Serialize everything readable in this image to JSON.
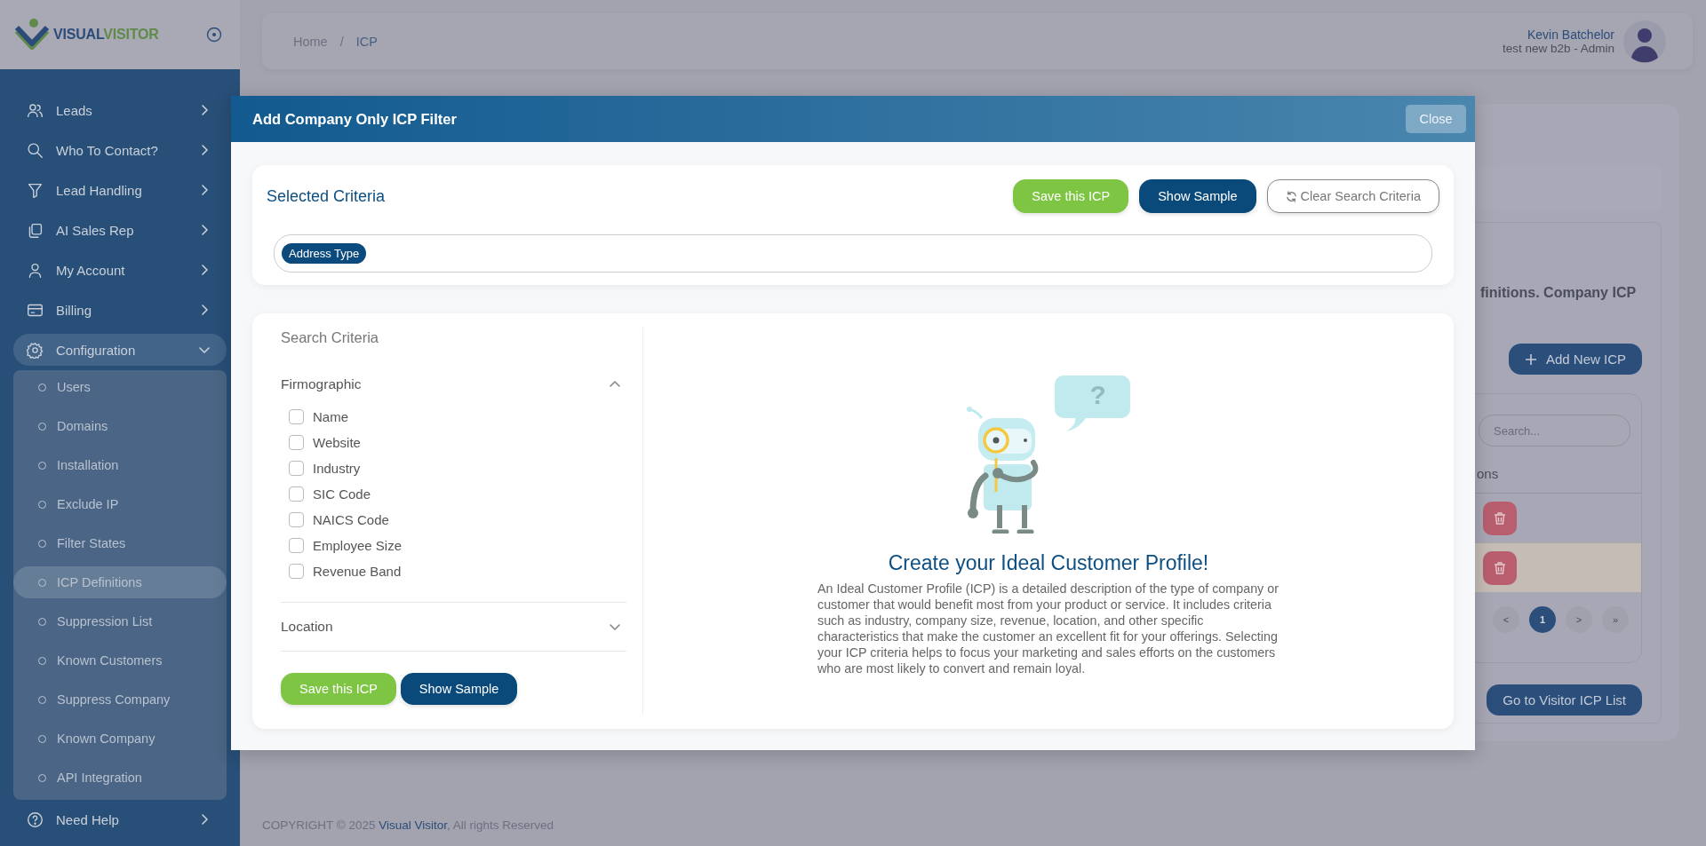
{
  "sidebar": {
    "logo": {
      "part_1": "VISUAL",
      "part_2": "VISITOR"
    },
    "items": [
      {
        "label": "Leads",
        "expanded": false,
        "selected": false
      },
      {
        "label": "Who To Contact?",
        "expanded": false,
        "selected": false
      },
      {
        "label": "Lead Handling",
        "expanded": false,
        "selected": false
      },
      {
        "label": "AI Sales Rep",
        "expanded": false,
        "selected": false
      },
      {
        "label": "My Account",
        "expanded": false,
        "selected": false
      },
      {
        "label": "Billing",
        "expanded": false,
        "selected": false
      },
      {
        "label": "Configuration",
        "expanded": true,
        "selected": true,
        "children": [
          {
            "label": "Users",
            "selected": false
          },
          {
            "label": "Domains",
            "selected": false
          },
          {
            "label": "Installation",
            "selected": false
          },
          {
            "label": "Exclude IP",
            "selected": false
          },
          {
            "label": "Filter States",
            "selected": false
          },
          {
            "label": "ICP Definitions",
            "selected": true
          },
          {
            "label": "Suppression List",
            "selected": false
          },
          {
            "label": "Known Customers",
            "selected": false
          },
          {
            "label": "Suppress Company",
            "selected": false
          },
          {
            "label": "Known Company",
            "selected": false
          },
          {
            "label": "API Integration",
            "selected": false
          }
        ]
      },
      {
        "label": "Need Help",
        "expanded": false,
        "selected": false
      }
    ]
  },
  "topbar": {
    "breadcrumb": [
      "Home",
      "ICP"
    ],
    "separator": "/",
    "user": {
      "name": "Kevin Batchelor",
      "role": "test new b2b - Admin"
    }
  },
  "background": {
    "description_fragment": "finitions. Company ICP",
    "add_button": "Add New ICP",
    "search_placeholder": "Search...",
    "column_fragment": "ons",
    "rows": [
      {
        "selected": false
      },
      {
        "selected": true
      }
    ],
    "pagination": [
      {
        "label": "<",
        "selected": false
      },
      {
        "label": "1",
        "selected": true
      },
      {
        "label": ">",
        "selected": false
      },
      {
        "label": "»",
        "selected": false
      }
    ],
    "go_button": "Go to Visitor ICP List"
  },
  "modal": {
    "title": "Add Company Only ICP Filter",
    "close": "Close",
    "selected_criteria": {
      "title": "Selected Criteria",
      "buttons": [
        {
          "label": "Save this ICP",
          "kind": "save"
        },
        {
          "label": "Show Sample",
          "kind": "sample"
        },
        {
          "label": "Clear Search Criteria",
          "kind": "clear"
        }
      ],
      "chips": [
        "Address Type"
      ]
    },
    "search": {
      "title": "Search Criteria",
      "groups": [
        {
          "label": "Firmographic",
          "expanded": true,
          "options": [
            {
              "label": "Name",
              "checked": false
            },
            {
              "label": "Website",
              "checked": false
            },
            {
              "label": "Industry",
              "checked": false
            },
            {
              "label": "SIC Code",
              "checked": false
            },
            {
              "label": "NAICS Code",
              "checked": false
            },
            {
              "label": "Employee Size",
              "checked": false
            },
            {
              "label": "Revenue Band",
              "checked": false
            }
          ]
        },
        {
          "label": "Location",
          "expanded": false
        }
      ],
      "buttons": [
        {
          "label": "Save this ICP",
          "kind": "save"
        },
        {
          "label": "Show Sample",
          "kind": "sample"
        }
      ]
    },
    "empty_state": {
      "bubble_mark": "?",
      "title": "Create your Ideal Customer Profile!",
      "text": "An Ideal Customer Profile (ICP) is a detailed description of the type of company or customer that would benefit most from your product or service. It includes criteria such as industry, company size, revenue, location, and other specific characteristics that make the customer an excellent fit for your offerings. Selecting your ICP criteria helps to focus your marketing and sales efforts on the customers who are most likely to convert and remain loyal."
    }
  },
  "footer": {
    "text": "COPYRIGHT © 2025",
    "link": "Visual Visitor",
    "suffix": ", All rights Reserved"
  }
}
